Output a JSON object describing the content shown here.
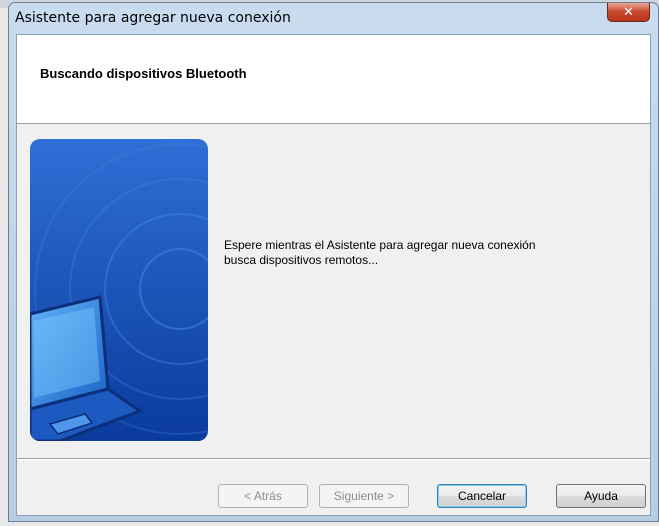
{
  "window": {
    "title": "Asistente para agregar nueva conexión",
    "close_glyph": "✕"
  },
  "header": {
    "title": "Buscando dispositivos Bluetooth"
  },
  "side_image": {
    "icon": "laptop-bluetooth-illustration",
    "colors": {
      "top": "#2f6fd6",
      "bottom": "#0a3b9c"
    }
  },
  "main": {
    "message_line1": "Espere mientras el Asistente para agregar nueva conexión",
    "message_line2": "busca dispositivos remotos..."
  },
  "buttons": {
    "back": "< Atrás",
    "next": "Siguiente >",
    "cancel": "Cancelar",
    "help": "Ayuda"
  }
}
